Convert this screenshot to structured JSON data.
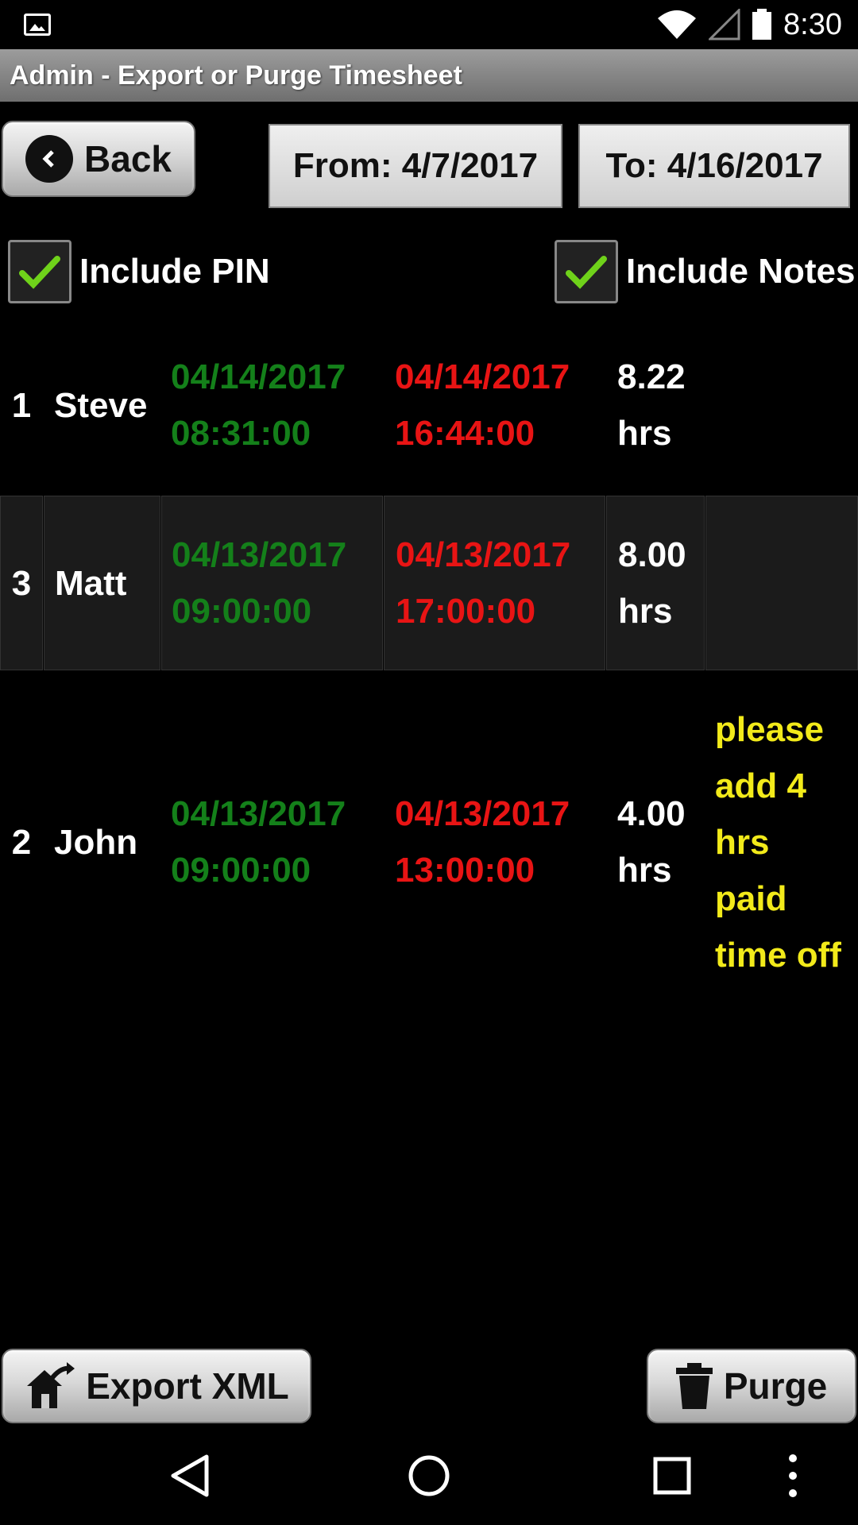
{
  "status_bar": {
    "time": "8:30",
    "icons": [
      "image-icon",
      "wifi-icon",
      "signal-icon",
      "battery-icon"
    ]
  },
  "title": "Admin - Export or Purge Timesheet",
  "toolbar": {
    "back_label": "Back",
    "from_label": "From: 4/7/2017",
    "to_label": "To: 4/16/2017"
  },
  "options": {
    "include_pin": {
      "label": "Include PIN",
      "checked": true
    },
    "include_notes": {
      "label": "Include Notes",
      "checked": true
    }
  },
  "entries": [
    {
      "num": "1",
      "name": "Steve",
      "in_date": "04/14/2017",
      "in_time": "08:31:00",
      "out_date": "04/14/2017",
      "out_time": "16:44:00",
      "hours_value": "8.22",
      "hours_unit": "hrs",
      "note": ""
    },
    {
      "num": "3",
      "name": "Matt",
      "in_date": "04/13/2017",
      "in_time": "09:00:00",
      "out_date": "04/13/2017",
      "out_time": "17:00:00",
      "hours_value": "8.00",
      "hours_unit": "hrs",
      "note": ""
    },
    {
      "num": "2",
      "name": "John",
      "in_date": "04/13/2017",
      "in_time": "09:00:00",
      "out_date": "04/13/2017",
      "out_time": "13:00:00",
      "hours_value": "4.00",
      "hours_unit": "hrs",
      "note_lines": [
        "please",
        "add 4",
        "hrs",
        "paid",
        "time off"
      ]
    }
  ],
  "actions": {
    "export_label": "Export XML",
    "purge_label": "Purge"
  },
  "colors": {
    "clock_in": "#14801a",
    "clock_out": "#e81414",
    "note": "#f2ea1a"
  }
}
